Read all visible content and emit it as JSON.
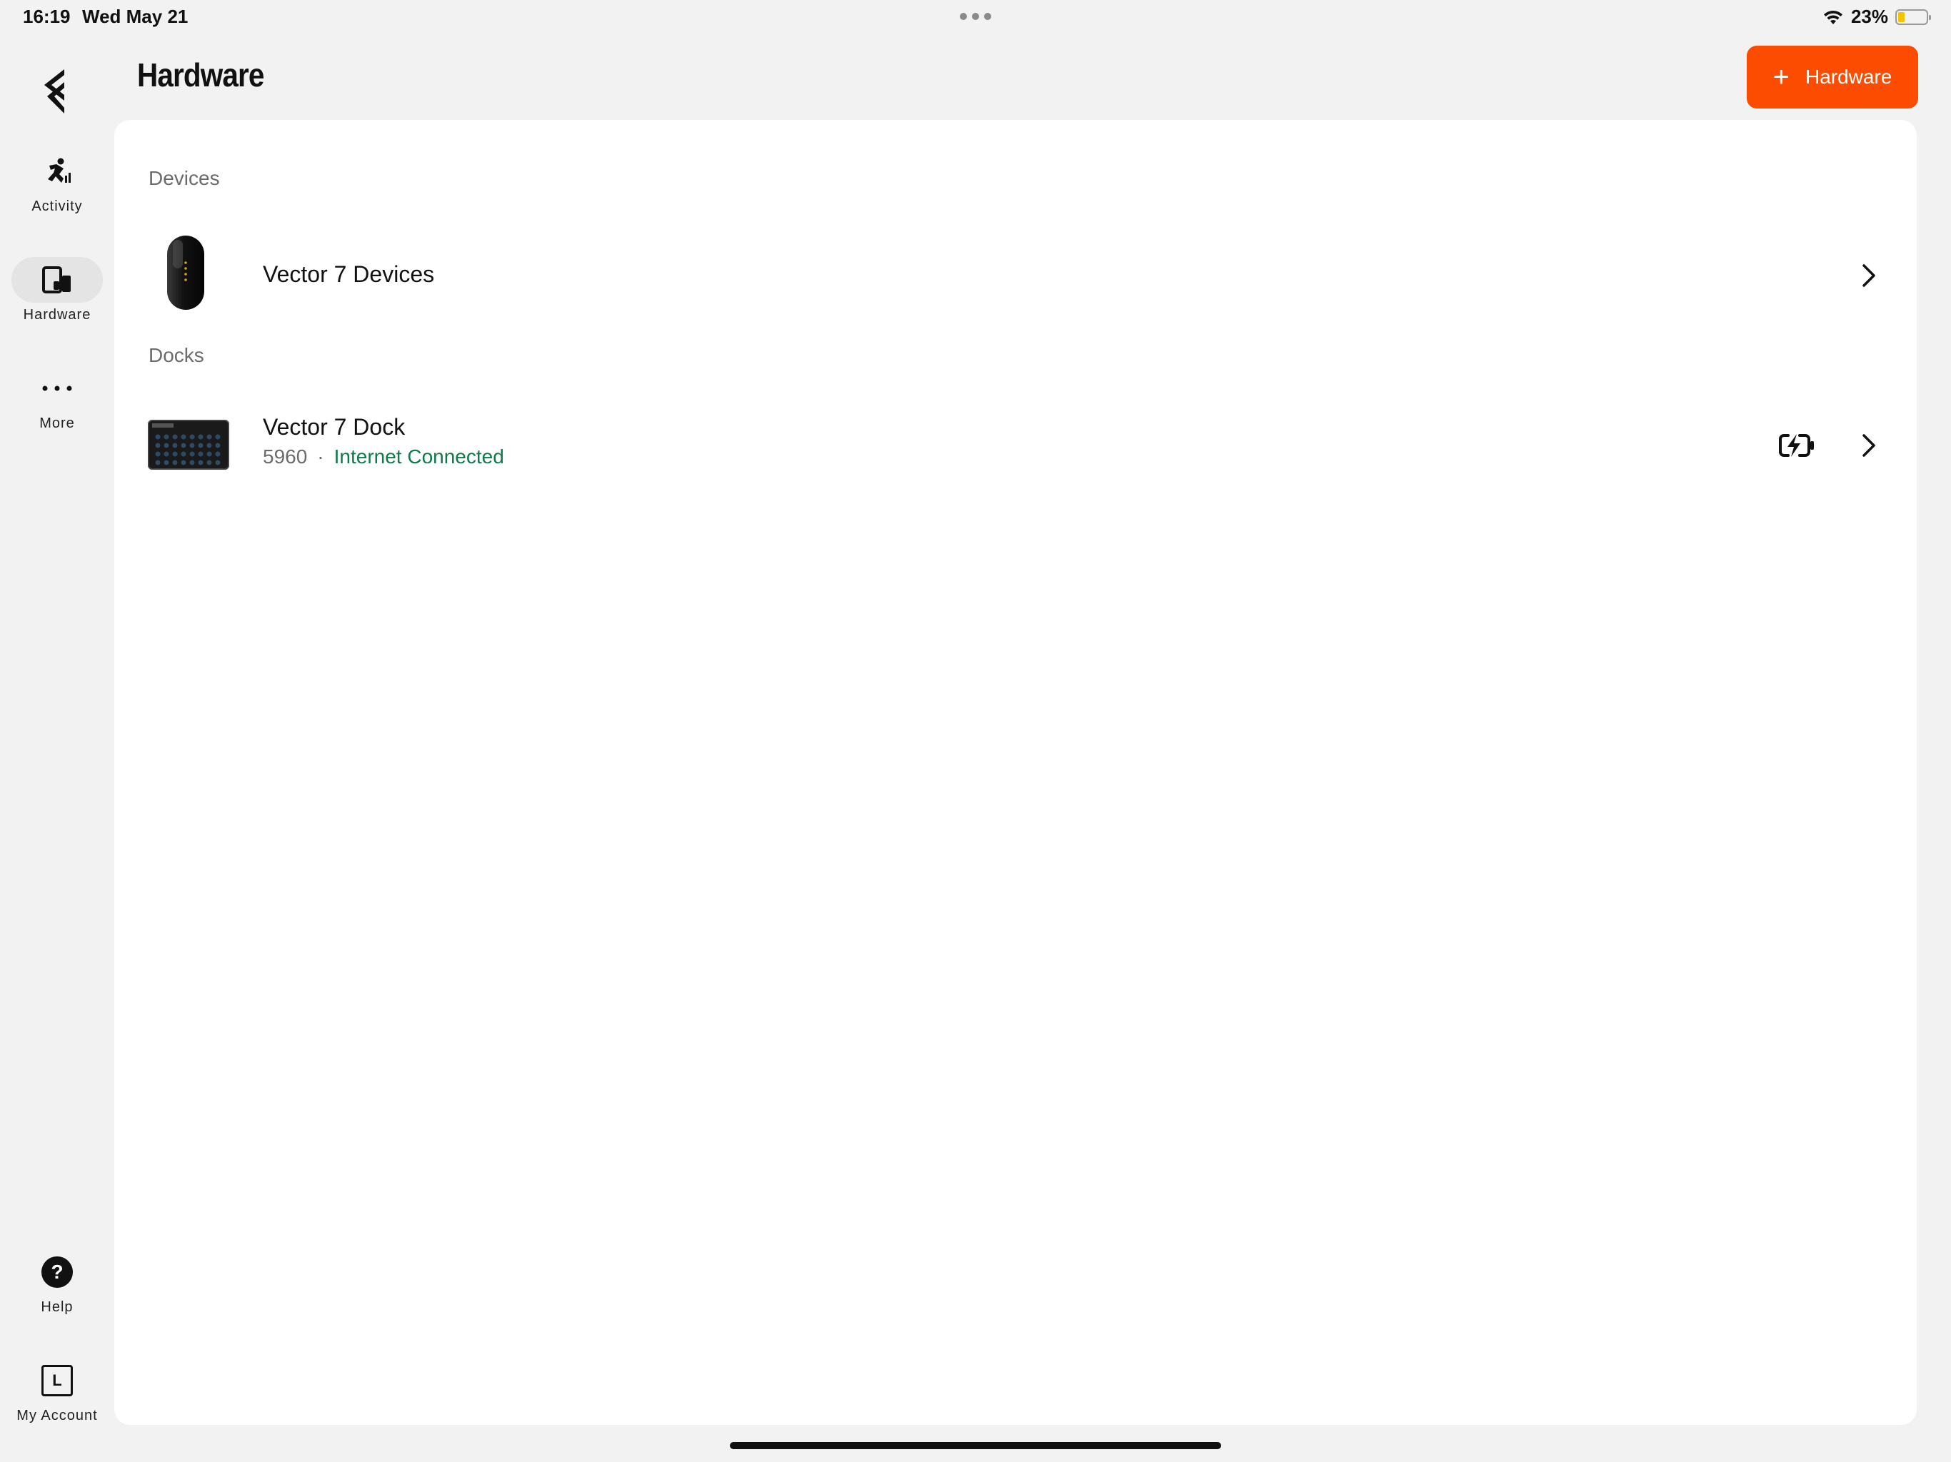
{
  "status_bar": {
    "time": "16:19",
    "date": "Wed May 21",
    "battery_percent": "23%",
    "battery_level": 0.23
  },
  "sidebar": {
    "items": [
      {
        "label": "Activity",
        "icon": "activity-runner-icon"
      },
      {
        "label": "Hardware",
        "icon": "hardware-icon",
        "active": true
      },
      {
        "label": "More",
        "icon": "more-dots-icon"
      },
      {
        "label": "Help",
        "icon": "help-icon"
      },
      {
        "label": "My Account",
        "icon": "account-icon",
        "avatar_letter": "L"
      }
    ]
  },
  "header": {
    "title": "Hardware",
    "add_button_label": "Hardware"
  },
  "sections": {
    "devices": {
      "title": "Devices",
      "items": [
        {
          "name": "Vector 7 Devices"
        }
      ]
    },
    "docks": {
      "title": "Docks",
      "items": [
        {
          "name": "Vector 7 Dock",
          "id": "5960",
          "separator": "·",
          "status": "Internet Connected"
        }
      ]
    }
  },
  "colors": {
    "accent": "#fc4c02",
    "connected": "#0d7a4b",
    "background": "#f2f2f2",
    "card": "#ffffff"
  }
}
